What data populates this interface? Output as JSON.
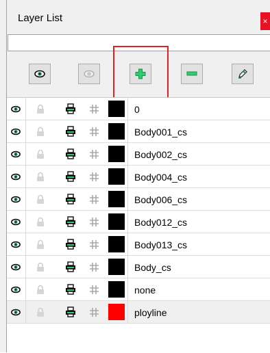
{
  "panel": {
    "title": "Layer List",
    "close_label": "×"
  },
  "filter": {
    "value": ""
  },
  "toolbar": {
    "buttons": [
      {
        "name": "show-all-button",
        "icon": "eye-icon"
      },
      {
        "name": "hide-all-button",
        "icon": "eye-disabled-icon"
      },
      {
        "name": "add-layer-button",
        "icon": "plus-icon"
      },
      {
        "name": "remove-layer-button",
        "icon": "minus-icon"
      },
      {
        "name": "edit-layer-button",
        "icon": "pencil-icon"
      }
    ]
  },
  "colors": {
    "icon_green": "#1e8f5a",
    "plus_green": "#2ecc71",
    "highlight": "#e02020"
  },
  "layers": [
    {
      "name": "0",
      "color": "#000000"
    },
    {
      "name": "Body001_cs",
      "color": "#000000"
    },
    {
      "name": "Body002_cs",
      "color": "#000000"
    },
    {
      "name": "Body004_cs",
      "color": "#000000"
    },
    {
      "name": "Body006_cs",
      "color": "#000000"
    },
    {
      "name": "Body012_cs",
      "color": "#000000"
    },
    {
      "name": "Body013_cs",
      "color": "#000000"
    },
    {
      "name": "Body_cs",
      "color": "#000000"
    },
    {
      "name": "none",
      "color": "#000000"
    },
    {
      "name": "ployline",
      "color": "#ff0000",
      "selected": true
    }
  ]
}
